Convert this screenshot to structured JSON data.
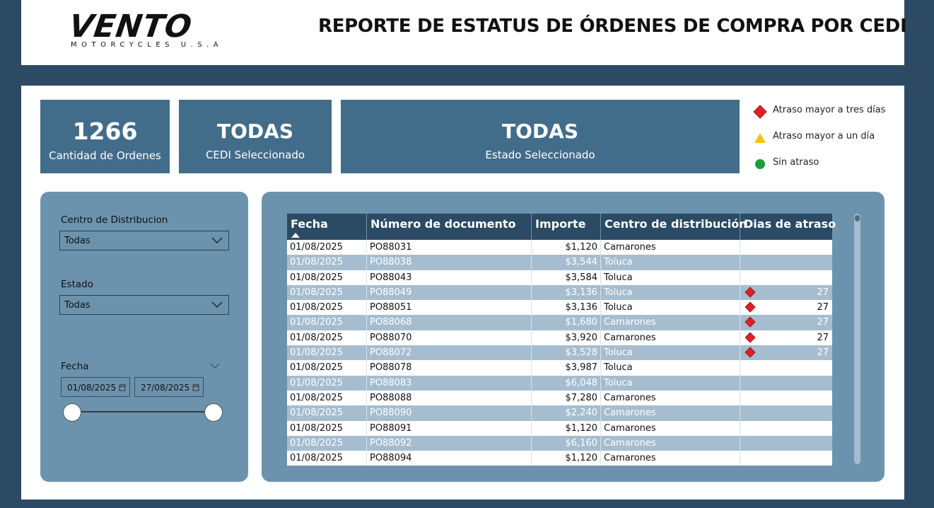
{
  "header": {
    "logo_main": "VENTO",
    "logo_sub": "MOTORCYCLES U.S.A",
    "title": "REPORTE DE ESTATUS DE ÓRDENES DE COMPRA POR CEDI"
  },
  "cards": {
    "orders": {
      "value": "1266",
      "label": "Cantidad de Ordenes"
    },
    "cedi": {
      "value": "TODAS",
      "label": "CEDI Seleccionado"
    },
    "estado": {
      "value": "TODAS",
      "label": "Estado Seleccionado"
    }
  },
  "legend": [
    {
      "icon": "red-diamond-icon",
      "label": "Atraso mayor a tres días",
      "color": "#e02020"
    },
    {
      "icon": "yellow-triangle-icon",
      "label": "Atraso mayor a un día",
      "color": "#f5c400"
    },
    {
      "icon": "green-circle-icon",
      "label": "Sin atraso",
      "color": "#1aa03a"
    }
  ],
  "filters": {
    "centro": {
      "label": "Centro de Distribucion",
      "value": "Todas"
    },
    "estado": {
      "label": "Estado",
      "value": "Todas"
    },
    "fecha": {
      "label": "Fecha",
      "start": "01/08/2025",
      "end": "27/08/2025"
    }
  },
  "table": {
    "columns": [
      "Fecha",
      "Número de documento",
      "Importe",
      "Centro de distribución",
      "Dias de atraso"
    ],
    "rows": [
      {
        "fecha": "01/08/2025",
        "doc": "PO88031",
        "importe": "$1,120",
        "centro": "Camarones",
        "dias": "",
        "flag": ""
      },
      {
        "fecha": "01/08/2025",
        "doc": "PO88038",
        "importe": "$3,544",
        "centro": "Toluca",
        "dias": "",
        "flag": ""
      },
      {
        "fecha": "01/08/2025",
        "doc": "PO88043",
        "importe": "$3,584",
        "centro": "Toluca",
        "dias": "",
        "flag": ""
      },
      {
        "fecha": "01/08/2025",
        "doc": "PO88049",
        "importe": "$3,136",
        "centro": "Toluca",
        "dias": "27",
        "flag": "red"
      },
      {
        "fecha": "01/08/2025",
        "doc": "PO88051",
        "importe": "$3,136",
        "centro": "Toluca",
        "dias": "27",
        "flag": "red"
      },
      {
        "fecha": "01/08/2025",
        "doc": "PO88068",
        "importe": "$1,680",
        "centro": "Camarones",
        "dias": "27",
        "flag": "red"
      },
      {
        "fecha": "01/08/2025",
        "doc": "PO88070",
        "importe": "$3,920",
        "centro": "Camarones",
        "dias": "27",
        "flag": "red"
      },
      {
        "fecha": "01/08/2025",
        "doc": "PO88072",
        "importe": "$3,528",
        "centro": "Toluca",
        "dias": "27",
        "flag": "red"
      },
      {
        "fecha": "01/08/2025",
        "doc": "PO88078",
        "importe": "$3,987",
        "centro": "Toluca",
        "dias": "",
        "flag": ""
      },
      {
        "fecha": "01/08/2025",
        "doc": "PO88083",
        "importe": "$6,048",
        "centro": "Toluca",
        "dias": "",
        "flag": ""
      },
      {
        "fecha": "01/08/2025",
        "doc": "PO88088",
        "importe": "$7,280",
        "centro": "Camarones",
        "dias": "",
        "flag": ""
      },
      {
        "fecha": "01/08/2025",
        "doc": "PO88090",
        "importe": "$2,240",
        "centro": "Camarones",
        "dias": "",
        "flag": ""
      },
      {
        "fecha": "01/08/2025",
        "doc": "PO88091",
        "importe": "$1,120",
        "centro": "Camarones",
        "dias": "",
        "flag": ""
      },
      {
        "fecha": "01/08/2025",
        "doc": "PO88092",
        "importe": "$6,160",
        "centro": "Camarones",
        "dias": "",
        "flag": ""
      },
      {
        "fecha": "01/08/2025",
        "doc": "PO88094",
        "importe": "$1,120",
        "centro": "Camarones",
        "dias": "",
        "flag": ""
      }
    ]
  }
}
